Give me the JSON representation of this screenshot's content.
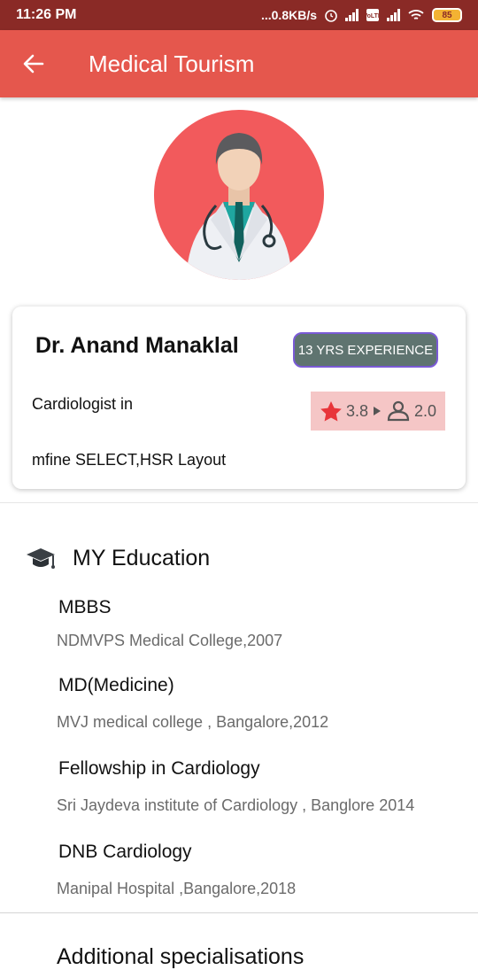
{
  "status_bar": {
    "time": "11:26 PM",
    "network_speed": "...0.8KB/s",
    "battery": "85",
    "icons": [
      "alarm-icon",
      "signal-icon",
      "volte-icon",
      "4g-signal-icon",
      "wifi-icon",
      "battery-icon"
    ]
  },
  "app_bar": {
    "title": "Medical Tourism",
    "back_icon": "arrow-left-icon",
    "color": "#e5574d"
  },
  "doctor": {
    "name": "Dr. Anand Manaklal",
    "experience": "13 YRS EXPERIENCE",
    "specialty": "Cardiologist in",
    "location": "mfine SELECT,HSR Layout",
    "rating": "3.8",
    "patient_rating": "2.0",
    "avatar_bg": "#f25a5c"
  },
  "education": {
    "heading": "MY Education",
    "icon": "graduation-cap-icon",
    "items": [
      {
        "degree": "MBBS",
        "institution": "NDMVPS Medical College,2007"
      },
      {
        "degree": "MD(Medicine)",
        "institution": "MVJ medical college , Bangalore,2012"
      },
      {
        "degree": "Fellowship in Cardiology",
        "institution": "Sri Jaydeva institute of Cardiology , Banglore 2014"
      },
      {
        "degree": "DNB Cardiology",
        "institution": "Manipal Hospital ,Bangalore,2018"
      }
    ]
  },
  "additional": {
    "heading": "Additional specialisations"
  }
}
